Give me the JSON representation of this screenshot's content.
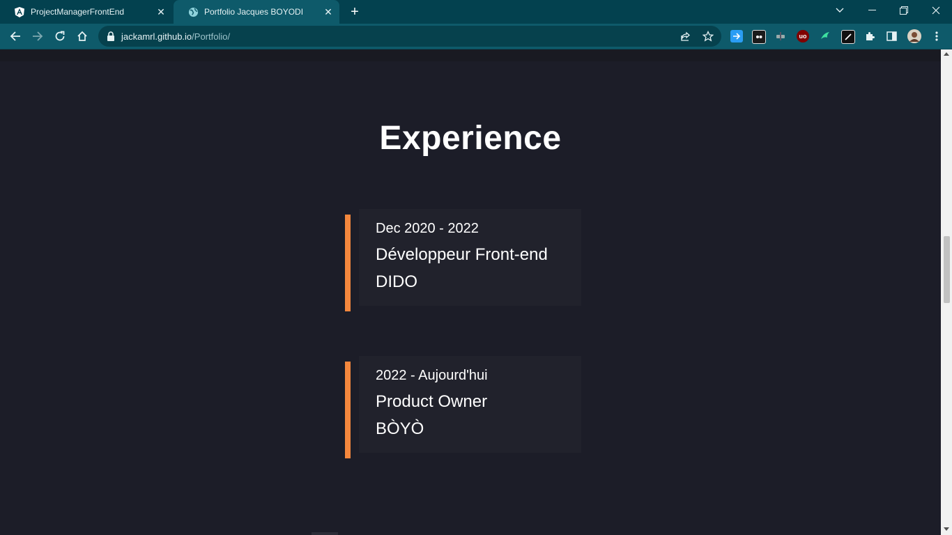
{
  "browser": {
    "tabs": [
      {
        "title": "ProjectManagerFrontEnd",
        "icon": "angular-icon",
        "active": false
      },
      {
        "title": "Portfolio Jacques BOYODI",
        "icon": "globe-icon",
        "active": true
      }
    ],
    "address": {
      "host": "jackamrl.github.io",
      "path": "/Portfolio/"
    },
    "colors": {
      "tabstrip": "#03414f",
      "toolbar": "#0e5a6a",
      "omnibox": "#06414d"
    }
  },
  "page": {
    "section_title": "Experience",
    "experiences": [
      {
        "date": "Dec 2020 - 2022",
        "role": "Développeur Front-end",
        "company": "DIDO"
      },
      {
        "date": "2022 - Aujourd'hui",
        "role": "Product Owner",
        "company": "BÒYÒ"
      }
    ],
    "colors": {
      "background": "#1c1d28",
      "card": "#21222c",
      "accent": "#f4873d",
      "text": "#ffffff"
    }
  }
}
